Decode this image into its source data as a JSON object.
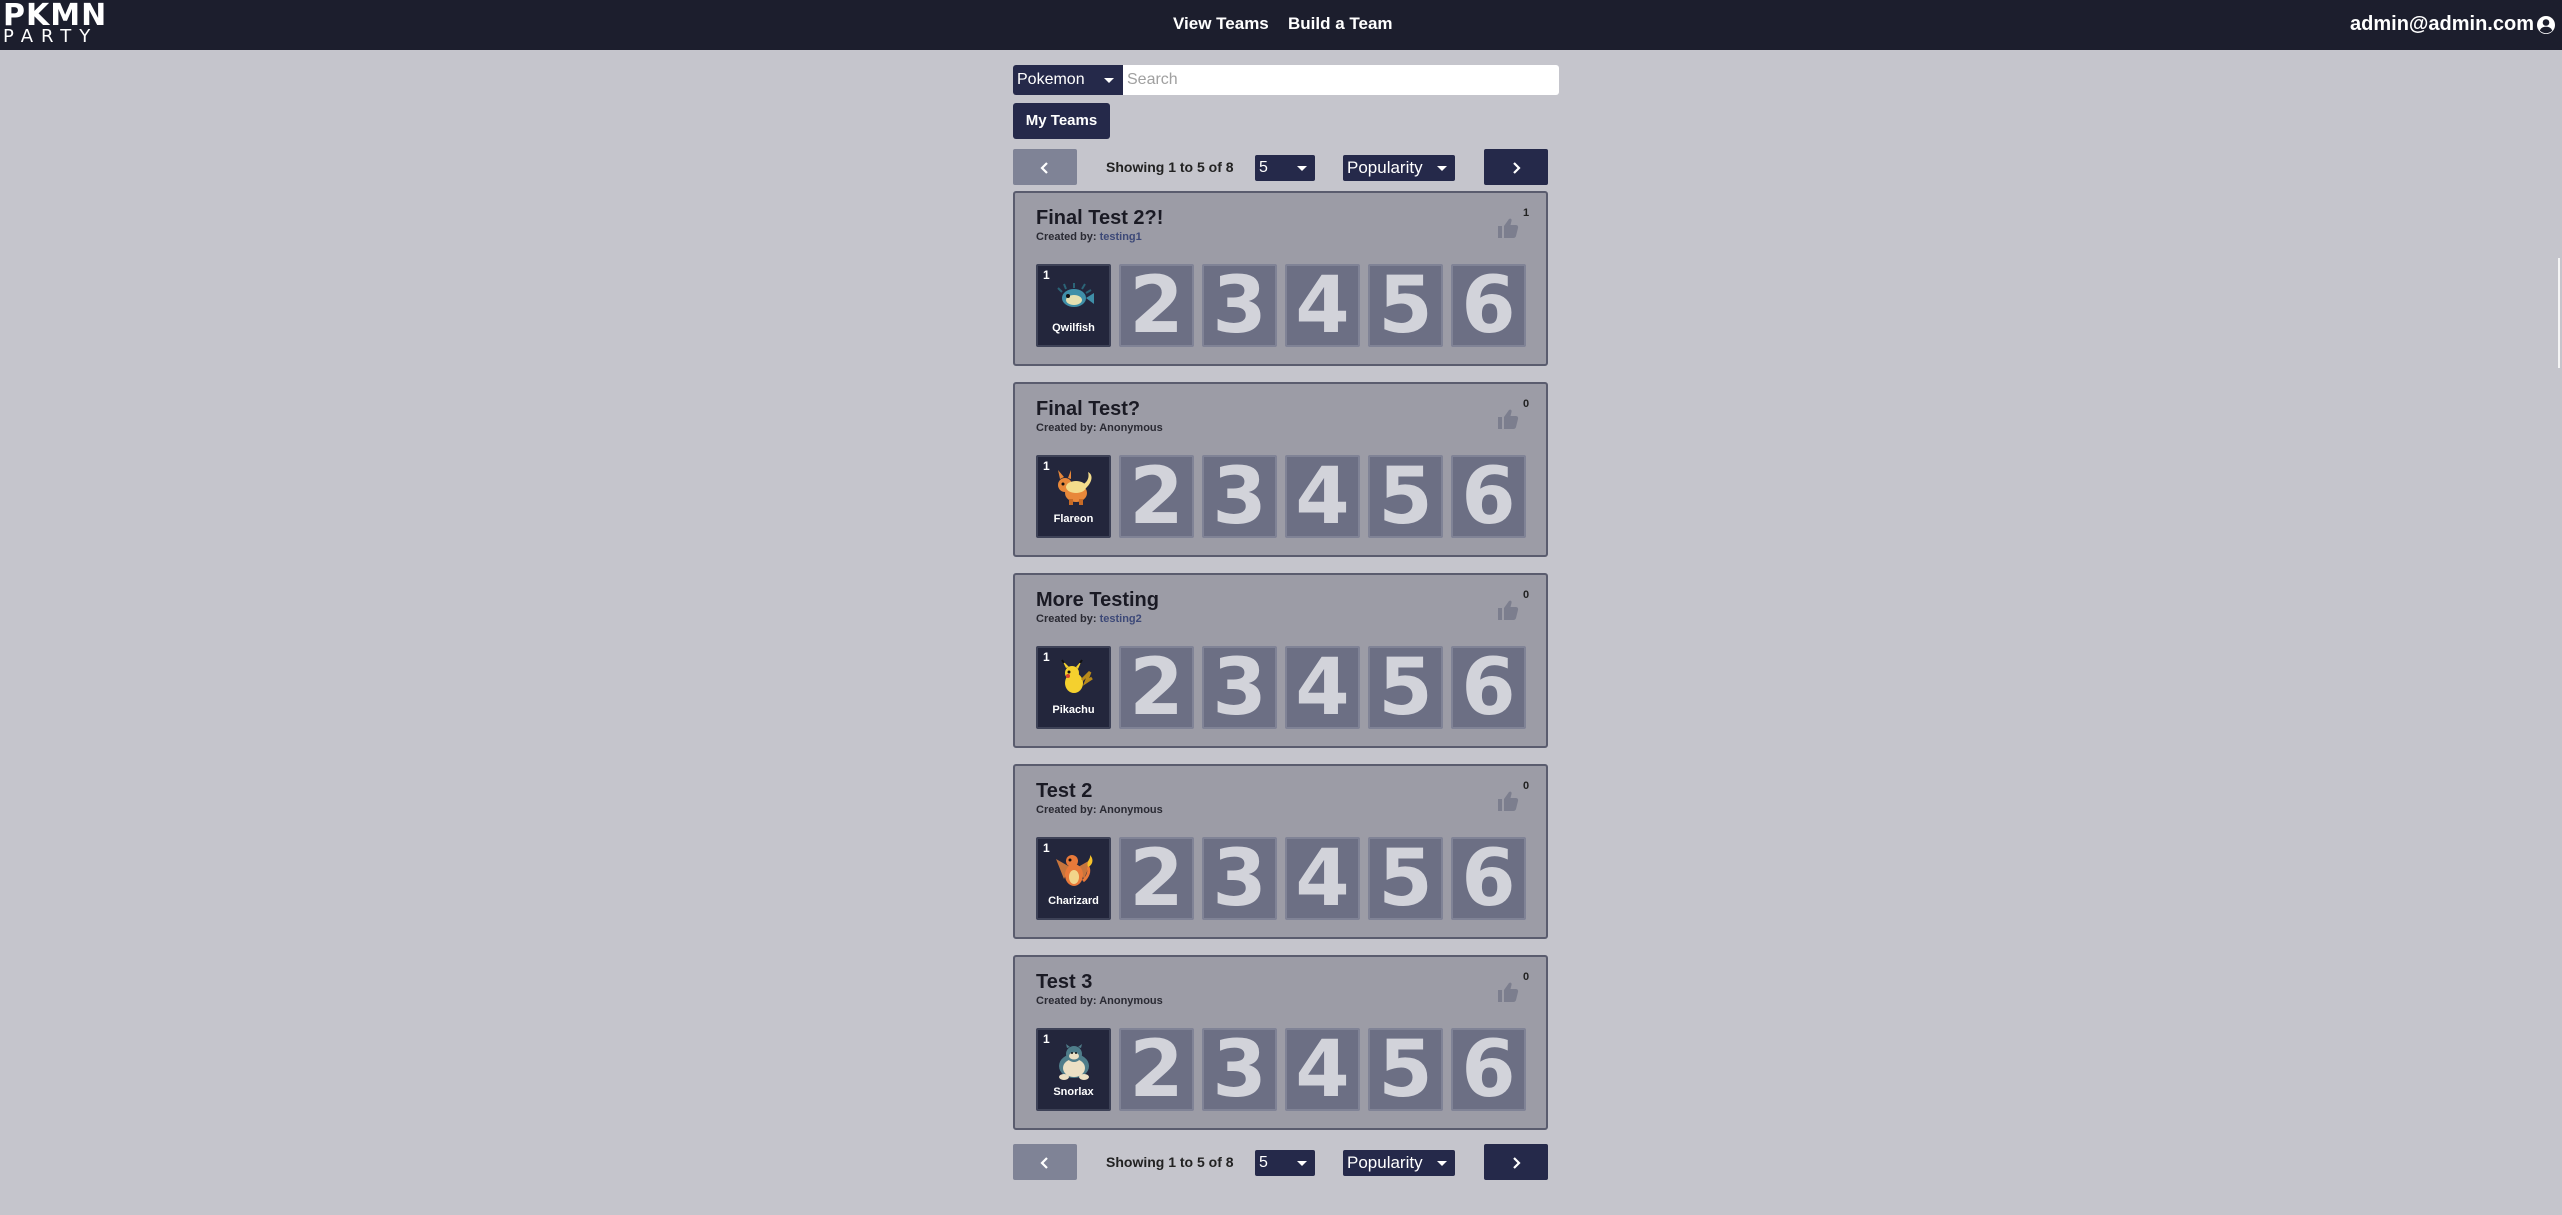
{
  "navbar": {
    "logo_line1": "PKMN",
    "logo_line2": "PARTY",
    "links": [
      "View Teams",
      "Build a Team"
    ],
    "user_email": "admin@admin.com"
  },
  "search": {
    "category": "Pokemon",
    "placeholder": "Search",
    "value": ""
  },
  "my_teams_label": "My Teams",
  "pagination": {
    "showing_text": "Showing 1 to 5 of 8",
    "page_size": "5",
    "sort": "Popularity"
  },
  "empty_slot_numbers": [
    "2",
    "3",
    "4",
    "5",
    "6"
  ],
  "teams": [
    {
      "title": "Final Test 2?!",
      "created_by_label": "Created by:",
      "creator": "testing1",
      "likes": "1",
      "slot_number": "1",
      "pokemon": "Qwilfish",
      "sprite_icon": "qwilfish-sprite-icon"
    },
    {
      "title": "Final Test?",
      "created_by_label": "Created by:",
      "creator": "Anonymous",
      "likes": "0",
      "slot_number": "1",
      "pokemon": "Flareon",
      "sprite_icon": "flareon-sprite-icon"
    },
    {
      "title": "More Testing",
      "created_by_label": "Created by:",
      "creator": "testing2",
      "likes": "0",
      "slot_number": "1",
      "pokemon": "Pikachu",
      "sprite_icon": "pikachu-sprite-icon"
    },
    {
      "title": "Test 2",
      "created_by_label": "Created by:",
      "creator": "Anonymous",
      "likes": "0",
      "slot_number": "1",
      "pokemon": "Charizard",
      "sprite_icon": "charizard-sprite-icon"
    },
    {
      "title": "Test 3",
      "created_by_label": "Created by:",
      "creator": "Anonymous",
      "likes": "0",
      "slot_number": "1",
      "pokemon": "Snorlax",
      "sprite_icon": "snorlax-sprite-icon"
    }
  ],
  "colors": {
    "navbar": "#1c1e2d",
    "page_background": "#c5c5cc",
    "card_background": "#9c9ca6",
    "accent": "#25294a",
    "link": "#3d4978"
  }
}
